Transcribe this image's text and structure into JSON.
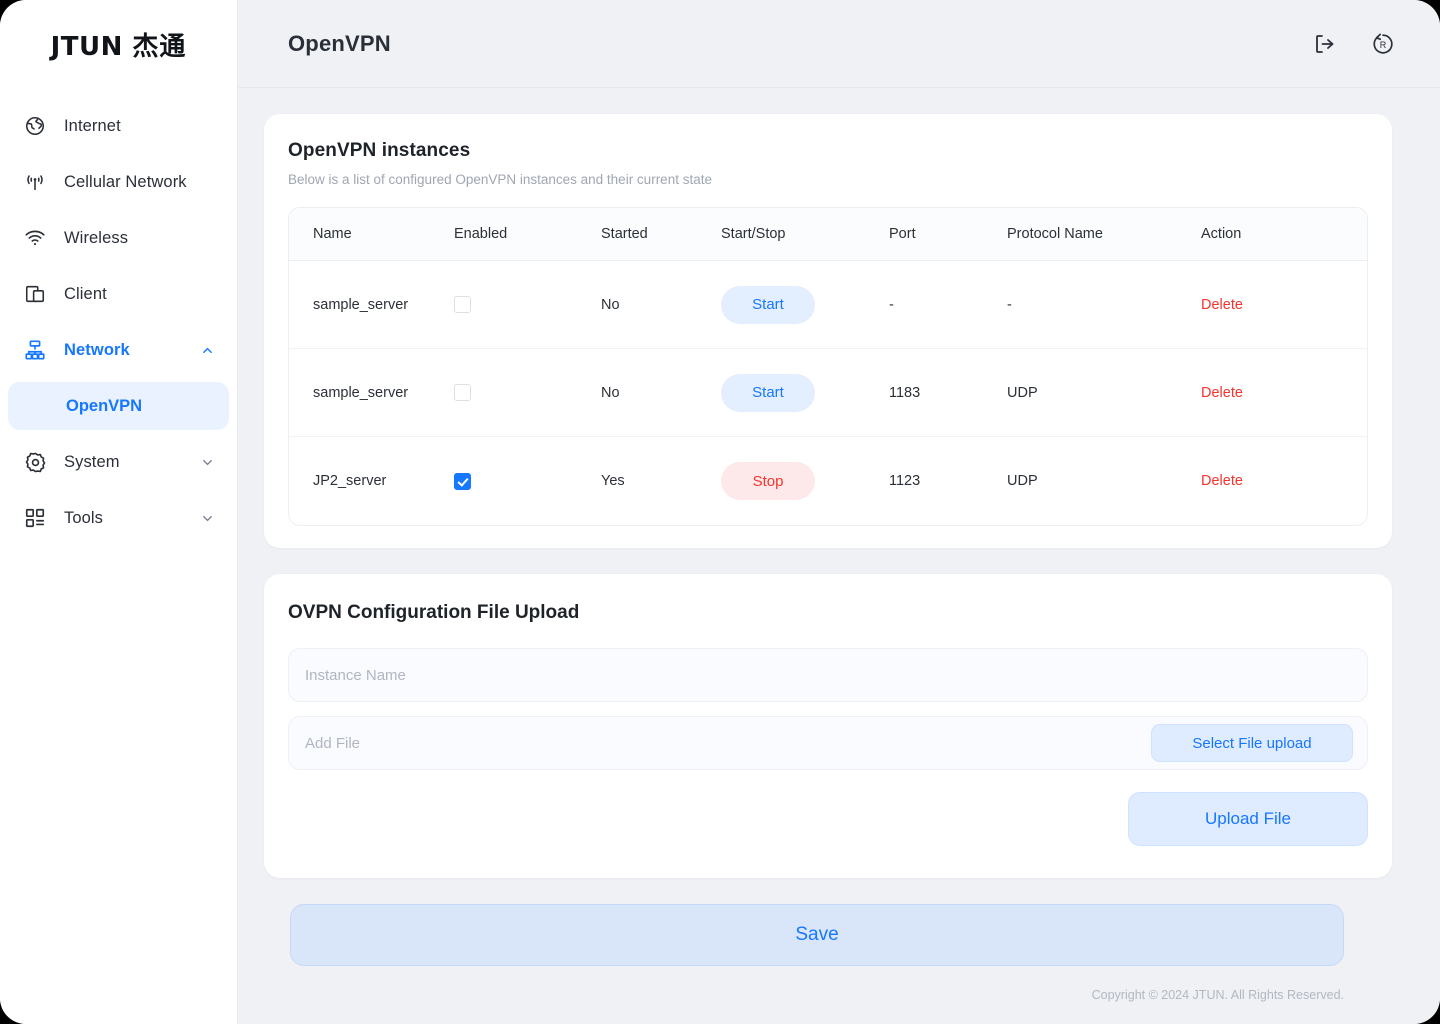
{
  "brand": {
    "logo_latin": "JTUN",
    "logo_cjk": "杰通"
  },
  "sidebar": {
    "items": [
      {
        "label": "Internet",
        "icon": "globe-icon",
        "type": "link",
        "active": false
      },
      {
        "label": "Cellular Network",
        "icon": "antenna-icon",
        "type": "link",
        "active": false
      },
      {
        "label": "Wireless",
        "icon": "wifi-icon",
        "type": "link",
        "active": false
      },
      {
        "label": "Client",
        "icon": "devices-icon",
        "type": "link",
        "active": false
      },
      {
        "label": "Network",
        "icon": "sitemap-icon",
        "type": "group",
        "active": true,
        "chevron": "chevron-up-icon"
      },
      {
        "label": "System",
        "icon": "gear-icon",
        "type": "group",
        "active": false,
        "chevron": "chevron-down-icon"
      },
      {
        "label": "Tools",
        "icon": "grid-icon",
        "type": "group",
        "active": false,
        "chevron": "chevron-down-icon"
      }
    ],
    "sub_item": {
      "label": "OpenVPN",
      "selected": true
    }
  },
  "header": {
    "title": "OpenVPN",
    "actions": [
      {
        "icon": "logout-icon",
        "name": "logout-button"
      },
      {
        "icon": "reboot-icon",
        "name": "reboot-button"
      }
    ]
  },
  "instances_card": {
    "title": "OpenVPN instances",
    "subtitle": "Below is a list of configured OpenVPN instances and their current state",
    "columns": [
      "Name",
      "Enabled",
      "Started",
      "Start/Stop",
      "Port",
      "Protocol Name",
      "Action"
    ],
    "rows": [
      {
        "name": "sample_server",
        "enabled": false,
        "started": "No",
        "action_label": "Start",
        "action_state": "start",
        "port": "-",
        "protocol": "-",
        "delete_label": "Delete"
      },
      {
        "name": "sample_server",
        "enabled": false,
        "started": "No",
        "action_label": "Start",
        "action_state": "start",
        "port": "1183",
        "protocol": "UDP",
        "delete_label": "Delete"
      },
      {
        "name": "JP2_server",
        "enabled": true,
        "started": "Yes",
        "action_label": "Stop",
        "action_state": "stop",
        "port": "1123",
        "protocol": "UDP",
        "delete_label": "Delete"
      }
    ]
  },
  "upload_card": {
    "title": "OVPN Configuration File Upload",
    "instance_name_value": "",
    "instance_name_placeholder": "Instance Name",
    "add_file_value": "",
    "add_file_placeholder": "Add File",
    "select_file_label": "Select File upload",
    "upload_file_label": "Upload File"
  },
  "save": {
    "label": "Save"
  },
  "footer": {
    "text": "Copyright © 2024 JTUN. All Rights Reserved."
  },
  "colors": {
    "accent": "#1677ff",
    "danger": "#f5342e",
    "start_bg": "#e3efff",
    "stop_bg": "#fde9e9",
    "page_bg": "#eff1f5"
  }
}
